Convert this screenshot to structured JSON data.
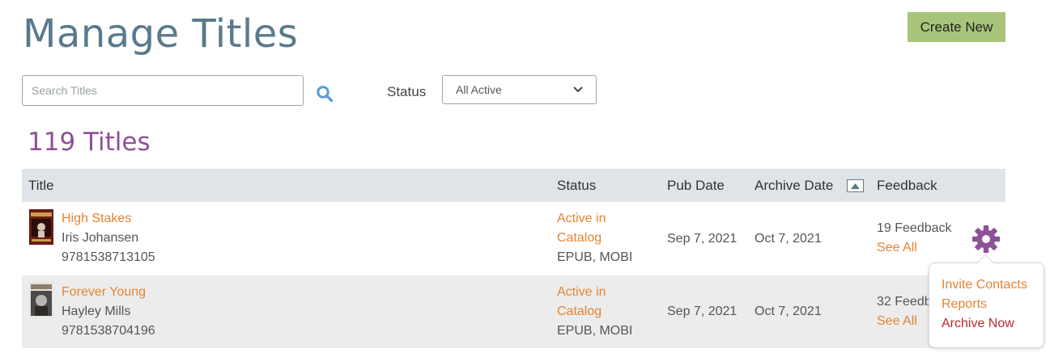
{
  "header": {
    "title": "Manage Titles",
    "create_label": "Create New"
  },
  "filters": {
    "search_placeholder": "Search Titles",
    "status_label": "Status",
    "status_selected": "All Active"
  },
  "summary": {
    "count_label": "119 Titles"
  },
  "table": {
    "columns": [
      "Title",
      "Status",
      "Pub Date",
      "Archive Date",
      "Feedback"
    ],
    "rows": [
      {
        "title": "High Stakes",
        "author": "Iris Johansen",
        "isbn": "9781538713105",
        "status_line1": "Active in",
        "status_line2": "Catalog",
        "formats": "EPUB, MOBI",
        "pub_date": "Sep 7, 2021",
        "archive_date": "Oct 7, 2021",
        "feedback": "19 Feedback",
        "see_all": "See All"
      },
      {
        "title": "Forever Young",
        "author": "Hayley Mills",
        "isbn": "9781538704196",
        "status_line1": "Active in",
        "status_line2": "Catalog",
        "formats": "EPUB, MOBI",
        "pub_date": "Sep 7, 2021",
        "archive_date": "Oct 7, 2021",
        "feedback": "32 Feedb",
        "see_all": "See All"
      }
    ]
  },
  "action_menu": {
    "items": [
      "Invite Contacts",
      "Reports",
      "Archive Now"
    ]
  },
  "colors": {
    "accent_orange": "#e58333",
    "title_blue": "#5a7a8c",
    "count_purple": "#8c5196",
    "gear_purple": "#8c5196",
    "create_green": "#a7c47a",
    "archive_red": "#c0272d"
  }
}
